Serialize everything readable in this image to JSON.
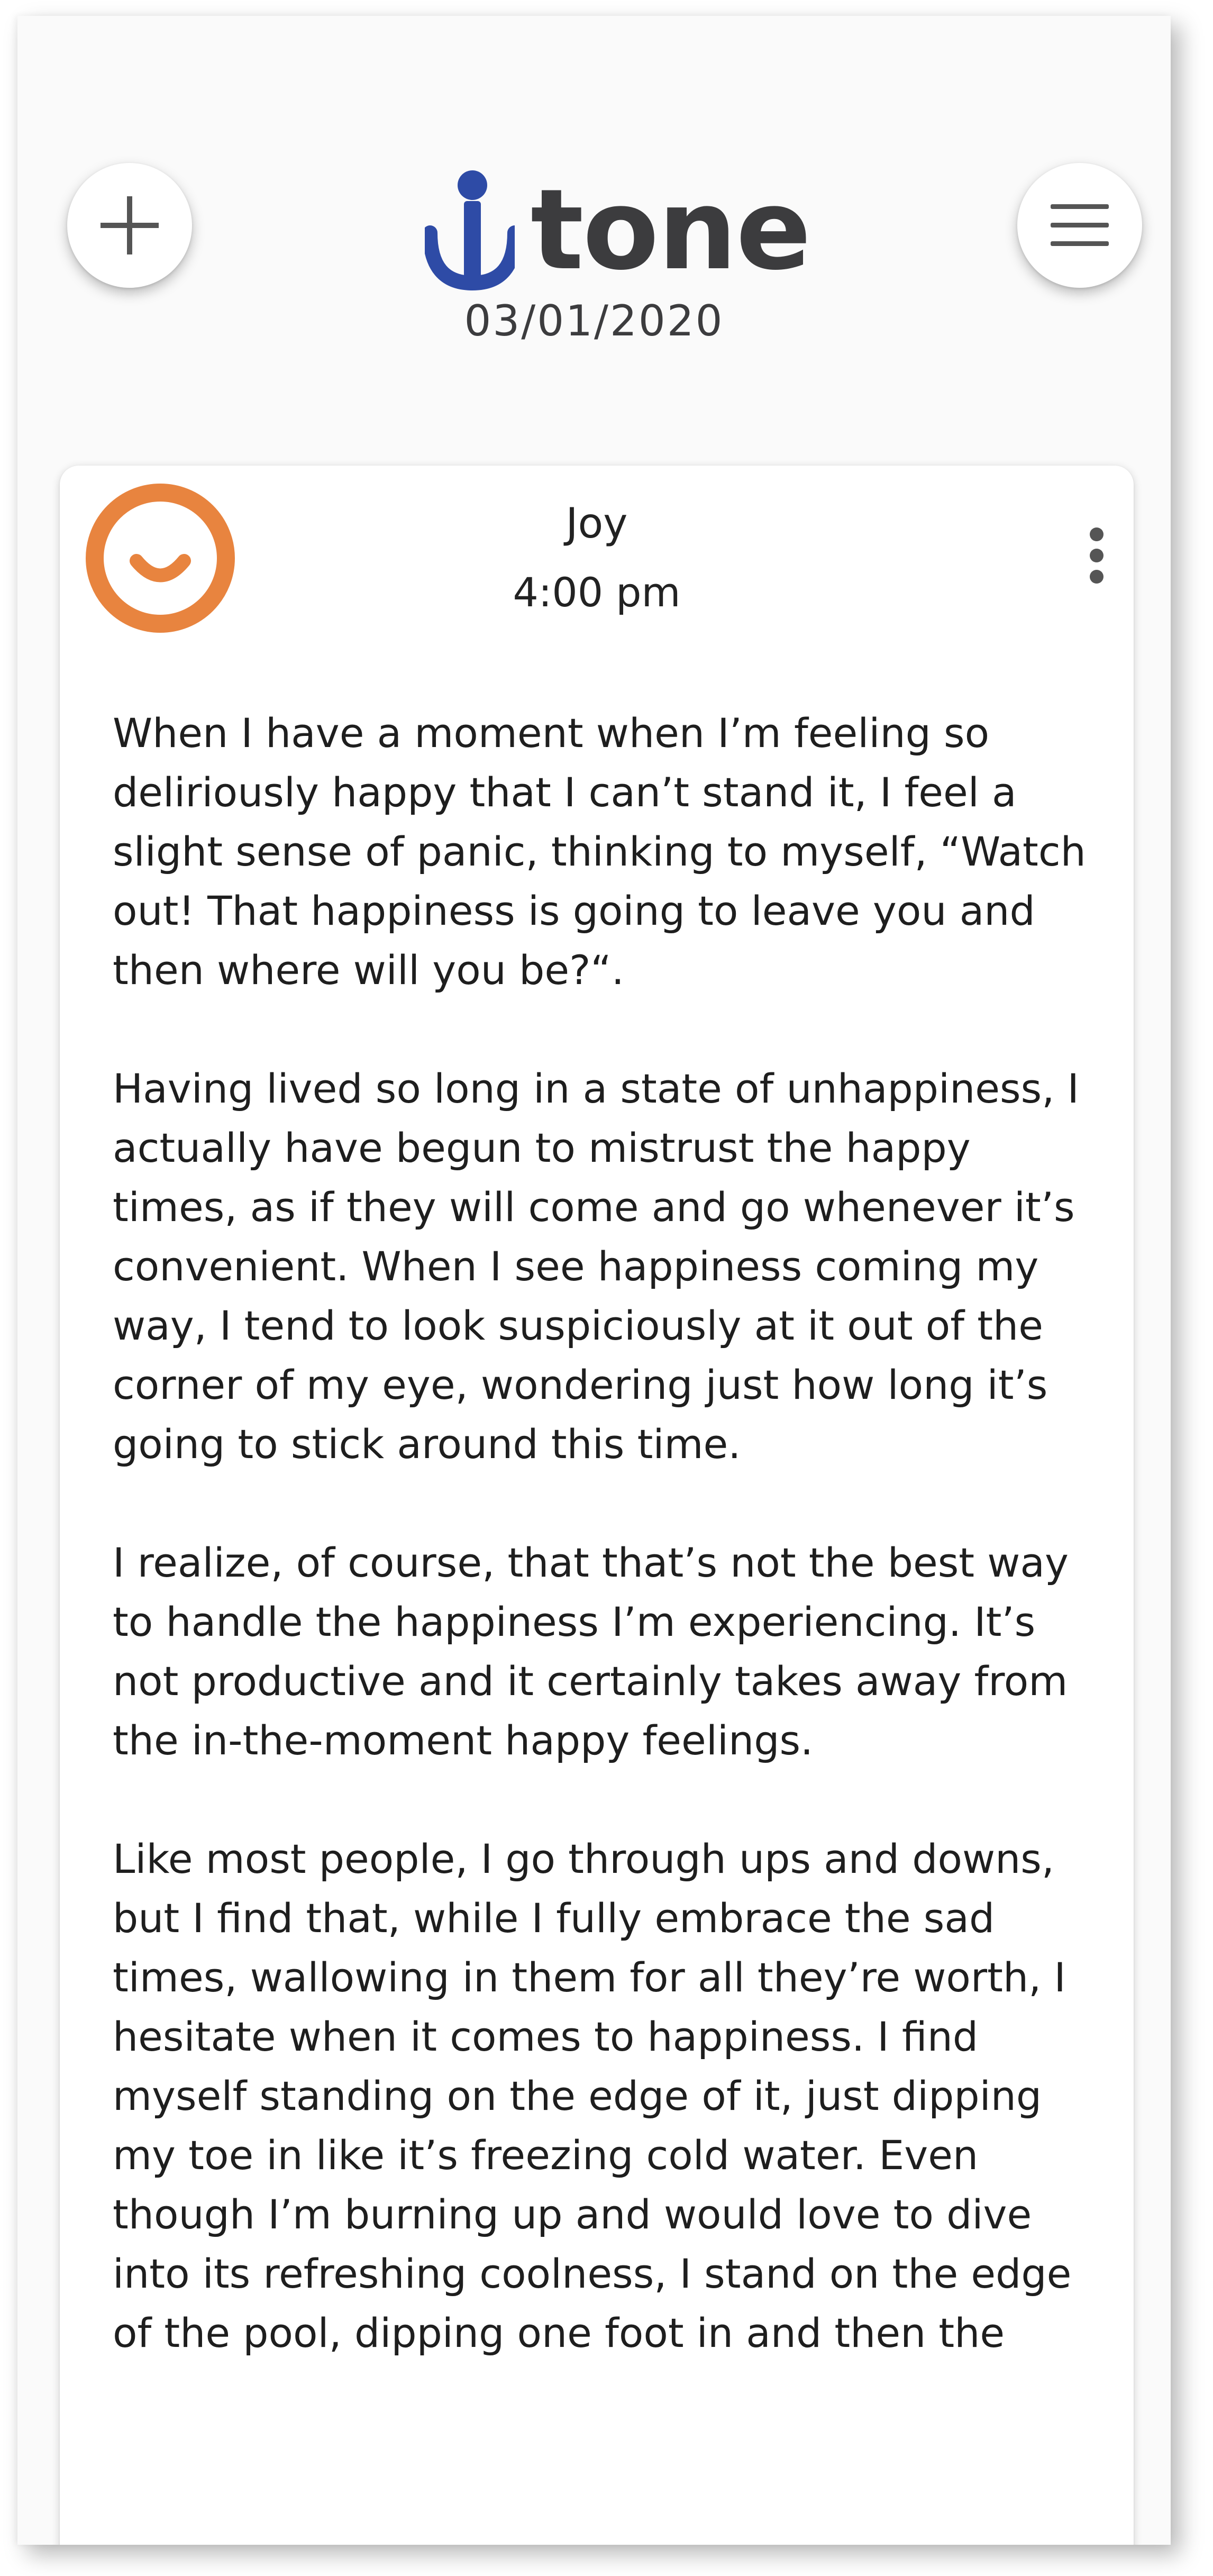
{
  "header": {
    "add_icon": "plus-icon",
    "menu_icon": "hamburger-menu-icon",
    "logo_text": "tone",
    "date": "03/01/2020"
  },
  "entry": {
    "mood": "Joy",
    "mood_icon": "smiley-face-icon",
    "mood_color": "#E8843F",
    "time": "4:00 pm",
    "more_icon": "vertical-dots-icon",
    "paragraphs": [
      "When I have a moment when I’m feeling so deliriously happy that I can’t stand it, I feel a slight sense of panic, thinking to myself, “Watch out! That happiness is going to leave you and then where will you be?“.",
      "Having lived so long in a state of unhappiness, I actually have begun to mistrust the happy times, as if they will come and go whenever it’s convenient. When I see happiness coming my way, I tend to look suspiciously at it out of the corner of my eye, wondering just how long it’s going to stick around this time.",
      "I realize, of course, that that’s not the best way to handle the happiness I’m experiencing. It’s not productive and it certainly takes away from the in-the-moment happy feelings.",
      "Like most people, I go through ups and downs, but I find that, while I fully embrace the sad times, wallowing in them for all they’re worth, I hesitate when it comes to happiness. I find myself standing on the edge of it, just dipping my toe in like it’s freezing cold water. Even though I’m burning up and would love to dive into its refreshing coolness, I stand on the edge of the pool, dipping one foot in and then the"
    ]
  },
  "colors": {
    "brand_blue": "#2E4BA6",
    "text_dark": "#3C3C3E",
    "joy_orange": "#E8843F"
  }
}
